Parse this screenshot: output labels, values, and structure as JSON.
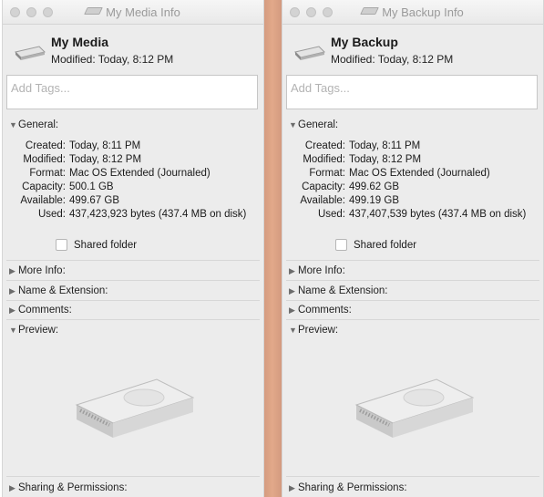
{
  "windows": [
    {
      "title": "My Media Info",
      "name": "My Media",
      "modified": "Modified: Today, 8:12 PM",
      "tags_placeholder": "Add Tags...",
      "general": {
        "label": "General:",
        "rows": [
          {
            "label": "Created:",
            "value": "Today, 8:11 PM"
          },
          {
            "label": "Modified:",
            "value": "Today, 8:12 PM"
          },
          {
            "label": "Format:",
            "value": "Mac OS Extended (Journaled)"
          },
          {
            "label": "Capacity:",
            "value": "500.1 GB"
          },
          {
            "label": "Available:",
            "value": "499.67 GB"
          },
          {
            "label": "Used:",
            "value": "437,423,923 bytes (437.4 MB on disk)"
          }
        ],
        "shared_label": "Shared folder"
      },
      "sections": {
        "more_info": "More Info:",
        "name_ext": "Name & Extension:",
        "comments": "Comments:",
        "preview": "Preview:",
        "sharing": "Sharing & Permissions:"
      }
    },
    {
      "title": "My Backup Info",
      "name": "My Backup",
      "modified": "Modified: Today, 8:12 PM",
      "tags_placeholder": "Add Tags...",
      "general": {
        "label": "General:",
        "rows": [
          {
            "label": "Created:",
            "value": "Today, 8:11 PM"
          },
          {
            "label": "Modified:",
            "value": "Today, 8:12 PM"
          },
          {
            "label": "Format:",
            "value": "Mac OS Extended (Journaled)"
          },
          {
            "label": "Capacity:",
            "value": "499.62 GB"
          },
          {
            "label": "Available:",
            "value": "499.19 GB"
          },
          {
            "label": "Used:",
            "value": "437,407,539 bytes (437.4 MB on disk)"
          }
        ],
        "shared_label": "Shared folder"
      },
      "sections": {
        "more_info": "More Info:",
        "name_ext": "Name & Extension:",
        "comments": "Comments:",
        "preview": "Preview:",
        "sharing": "Sharing & Permissions:"
      }
    }
  ],
  "icons": {
    "collapsed": "disclosure-triangle-right-icon",
    "expanded": "disclosure-triangle-down-icon",
    "drive": "external-drive-icon"
  },
  "colors": {
    "divider": "#d39a7f",
    "window_bg": "#ececec"
  }
}
